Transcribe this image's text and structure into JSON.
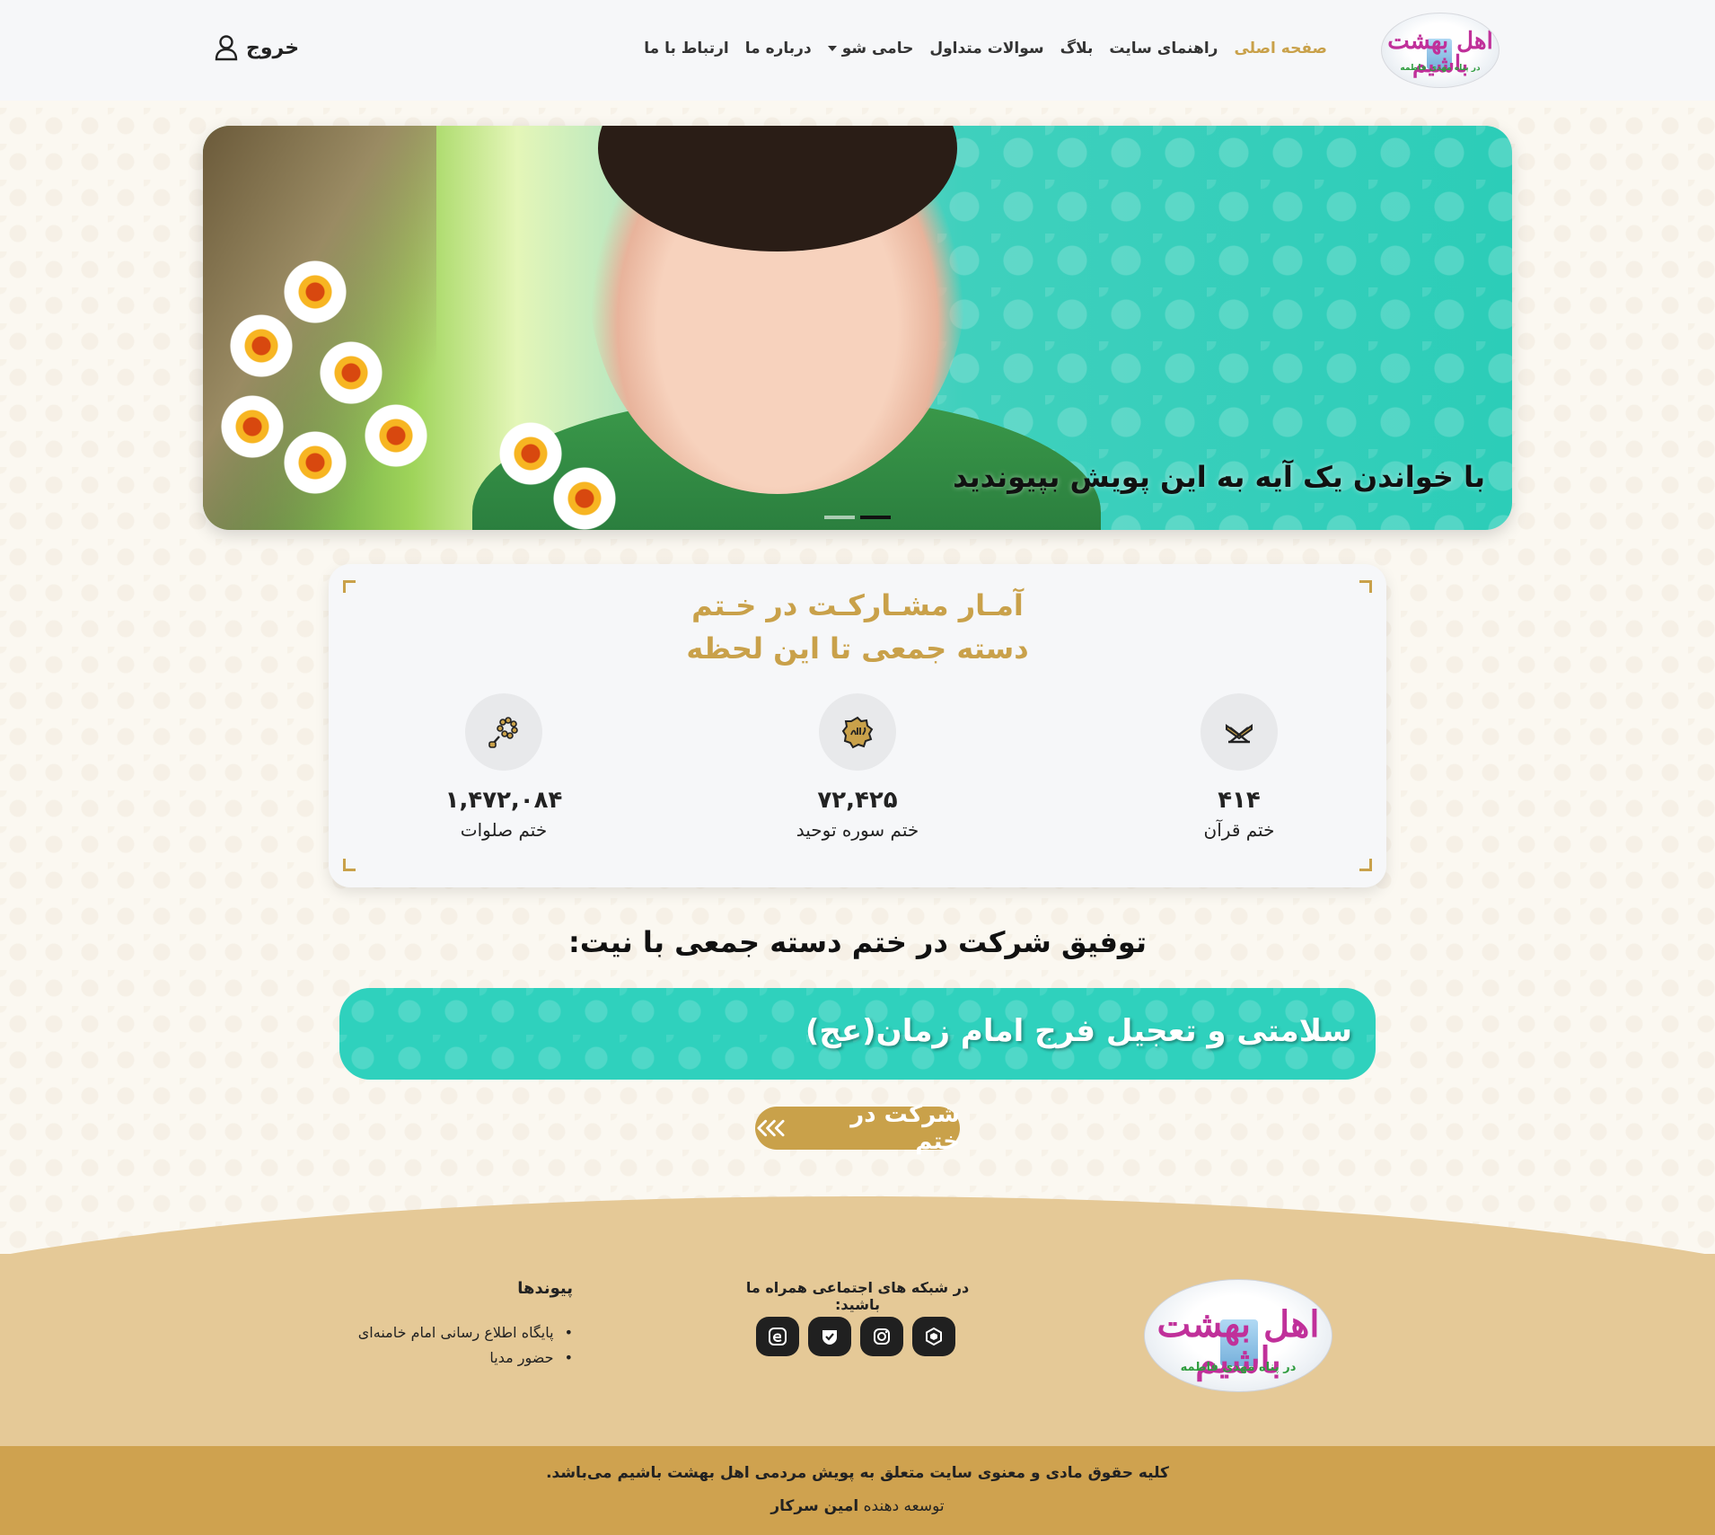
{
  "brand": {
    "logo_text": "اهل بهشت باشیم",
    "logo_subtext": "در پناه مهدی فاطمه"
  },
  "nav": {
    "items": [
      {
        "label": "صفحه اصلی",
        "active": true
      },
      {
        "label": "راهنمای سایت"
      },
      {
        "label": "بلاگ"
      },
      {
        "label": "سوالات متداول"
      },
      {
        "label": "حامی شو",
        "dropdown": true
      },
      {
        "label": "درباره ما"
      },
      {
        "label": "ارتباط با ما"
      }
    ],
    "logout_label": "خروج"
  },
  "hero": {
    "caption": "با خواندن یک آیه به این پویش بپیوندید",
    "slide_count": 2,
    "active_slide": 1
  },
  "stats": {
    "title_line1": "آمـار مشـارکـت در خـتم",
    "title_line2": "دسته جمعی تا این لحظه",
    "items": [
      {
        "icon": "quran-icon",
        "value": "۴۱۴",
        "label": "ختم قرآن"
      },
      {
        "icon": "allah-seal-icon",
        "value": "۷۲,۴۲۵",
        "label": "ختم سوره توحید"
      },
      {
        "icon": "prayer-beads-icon",
        "value": "۱,۴۷۲,۰۸۴",
        "label": "ختم صلوات"
      }
    ]
  },
  "intent": {
    "heading": "توفیق شرکت در ختم دسته جمعی با نیت:",
    "text": "سلامتی و تعجیل فرج امام زمان(عج)"
  },
  "join_button": "شرکت در ختم",
  "footer": {
    "social_title": "در شبکه های اجتماعی همراه ما باشید:",
    "social_icons": [
      "eitaa-icon",
      "bale-icon",
      "instagram-icon",
      "rubika-icon"
    ],
    "links_title": "پیوندها",
    "links": [
      "پایگاه اطلاع رسانی امام خامنه‌ای",
      "حضور مدیا"
    ],
    "copyright": "کلیه حقوق مادی و معنوی سایت متعلق به پویش مردمی اهل بهشت باشیم می‌باشد.",
    "developer_prefix": "توسعه دهنده",
    "developer_name": "امین سرکار"
  },
  "colors": {
    "gold": "#c9a14a",
    "teal": "#2fd1bd",
    "footer_bg": "#e5c997",
    "bottom_bar": "#cfa24f"
  }
}
